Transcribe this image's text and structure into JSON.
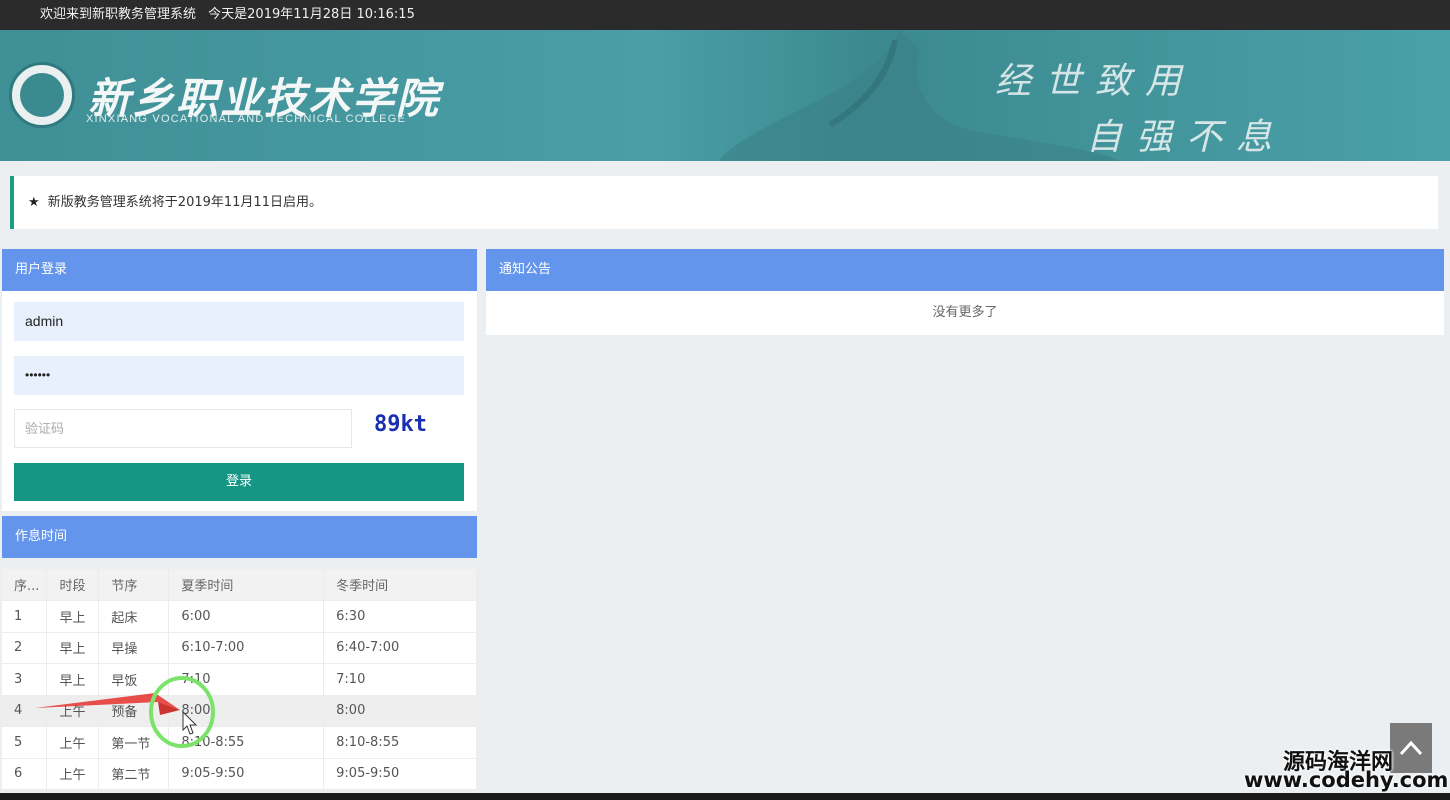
{
  "topbar": {
    "welcome": "欢迎来到新职教务管理系统",
    "datetime": "今天是2019年11月28日 10:16:15"
  },
  "banner": {
    "school_name": "新乡职业技术学院",
    "school_name_en": "XINXIANG VOCATIONAL AND TECHNICAL COLLEGE",
    "motto_line1": "经世致用",
    "motto_line2": "自强不息"
  },
  "announcement": {
    "icon": "star-icon",
    "text": "新版教务管理系统将于2019年11月11日启用。"
  },
  "login": {
    "title": "用户登录",
    "username_value": "admin",
    "password_value": "••••••",
    "captcha_placeholder": "验证码",
    "captcha_code": "89kt",
    "submit_label": "登录"
  },
  "notices": {
    "title": "通知公告",
    "empty_text": "没有更多了"
  },
  "schedule": {
    "title": "作息时间",
    "headers": [
      "序...",
      "时段",
      "节序",
      "夏季时间",
      "冬季时间"
    ],
    "rows": [
      [
        "1",
        "早上",
        "起床",
        "6:00",
        "6:30"
      ],
      [
        "2",
        "早上",
        "早操",
        "6:10-7:00",
        "6:40-7:00"
      ],
      [
        "3",
        "早上",
        "早饭",
        "7:10",
        "7:10"
      ],
      [
        "4",
        "上午",
        "预备",
        "8:00",
        "8:00"
      ],
      [
        "5",
        "上午",
        "第一节",
        "8:10-8:55",
        "8:10-8:55"
      ],
      [
        "6",
        "上午",
        "第二节",
        "9:05-9:50",
        "9:05-9:50"
      ]
    ]
  },
  "scroll_top": {
    "icon": "chevron-up-icon"
  },
  "watermark": {
    "line1": "源码海洋网",
    "line2": "www.codehy.com"
  },
  "colors": {
    "banner": "#4a9ea6",
    "panel_header": "#6495ed",
    "login_button": "#159684",
    "captcha": "#1a2fb0"
  }
}
